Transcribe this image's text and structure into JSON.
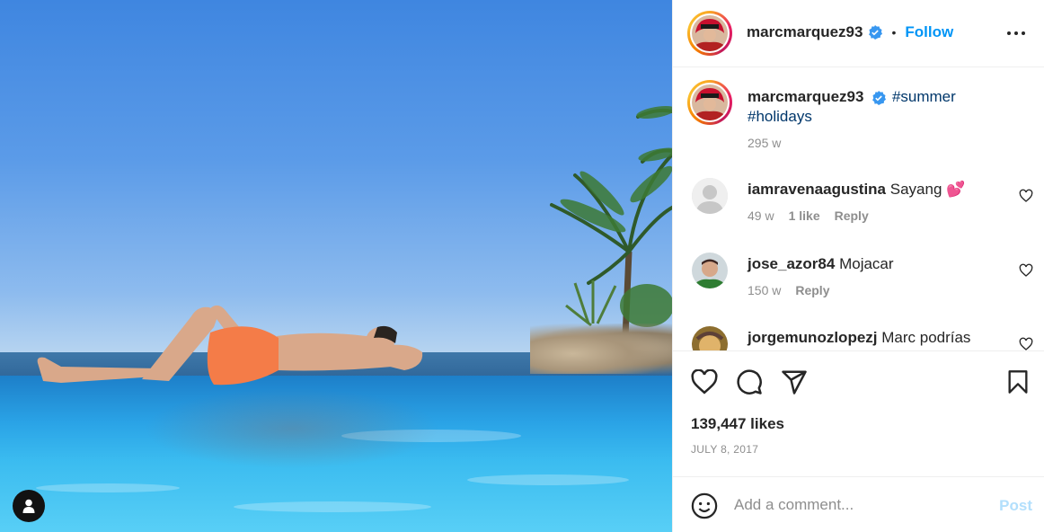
{
  "post": {
    "username": "marcmarquez93",
    "follow_label": "Follow",
    "separator": "•",
    "caption_hashtag_1": "#summer",
    "caption_hashtag_2": "#holidays",
    "caption_time": "295 w",
    "likes": "139,447 likes",
    "date": "JULY 8, 2017"
  },
  "comments": [
    {
      "username": "iamravenaagustina",
      "text": "Sayang",
      "emoji": "💕",
      "time": "49 w",
      "likes": "1 like",
      "reply": "Reply"
    },
    {
      "username": "jose_azor84",
      "text": "Mojacar",
      "time": "150 w",
      "reply": "Reply"
    },
    {
      "username": "jorgemunozlopezj",
      "text": "Marc podrías"
    }
  ],
  "comment_box": {
    "placeholder": "Add a comment...",
    "post_label": "Post"
  },
  "colors": {
    "accent": "#0095f6",
    "verified": "#3897f0",
    "post_disabled": "#b2dffc"
  },
  "icons": [
    "verified-badge-icon",
    "more-options-icon",
    "heart-icon",
    "comment-icon",
    "share-icon",
    "bookmark-icon",
    "emoji-icon",
    "user-tag-icon"
  ]
}
